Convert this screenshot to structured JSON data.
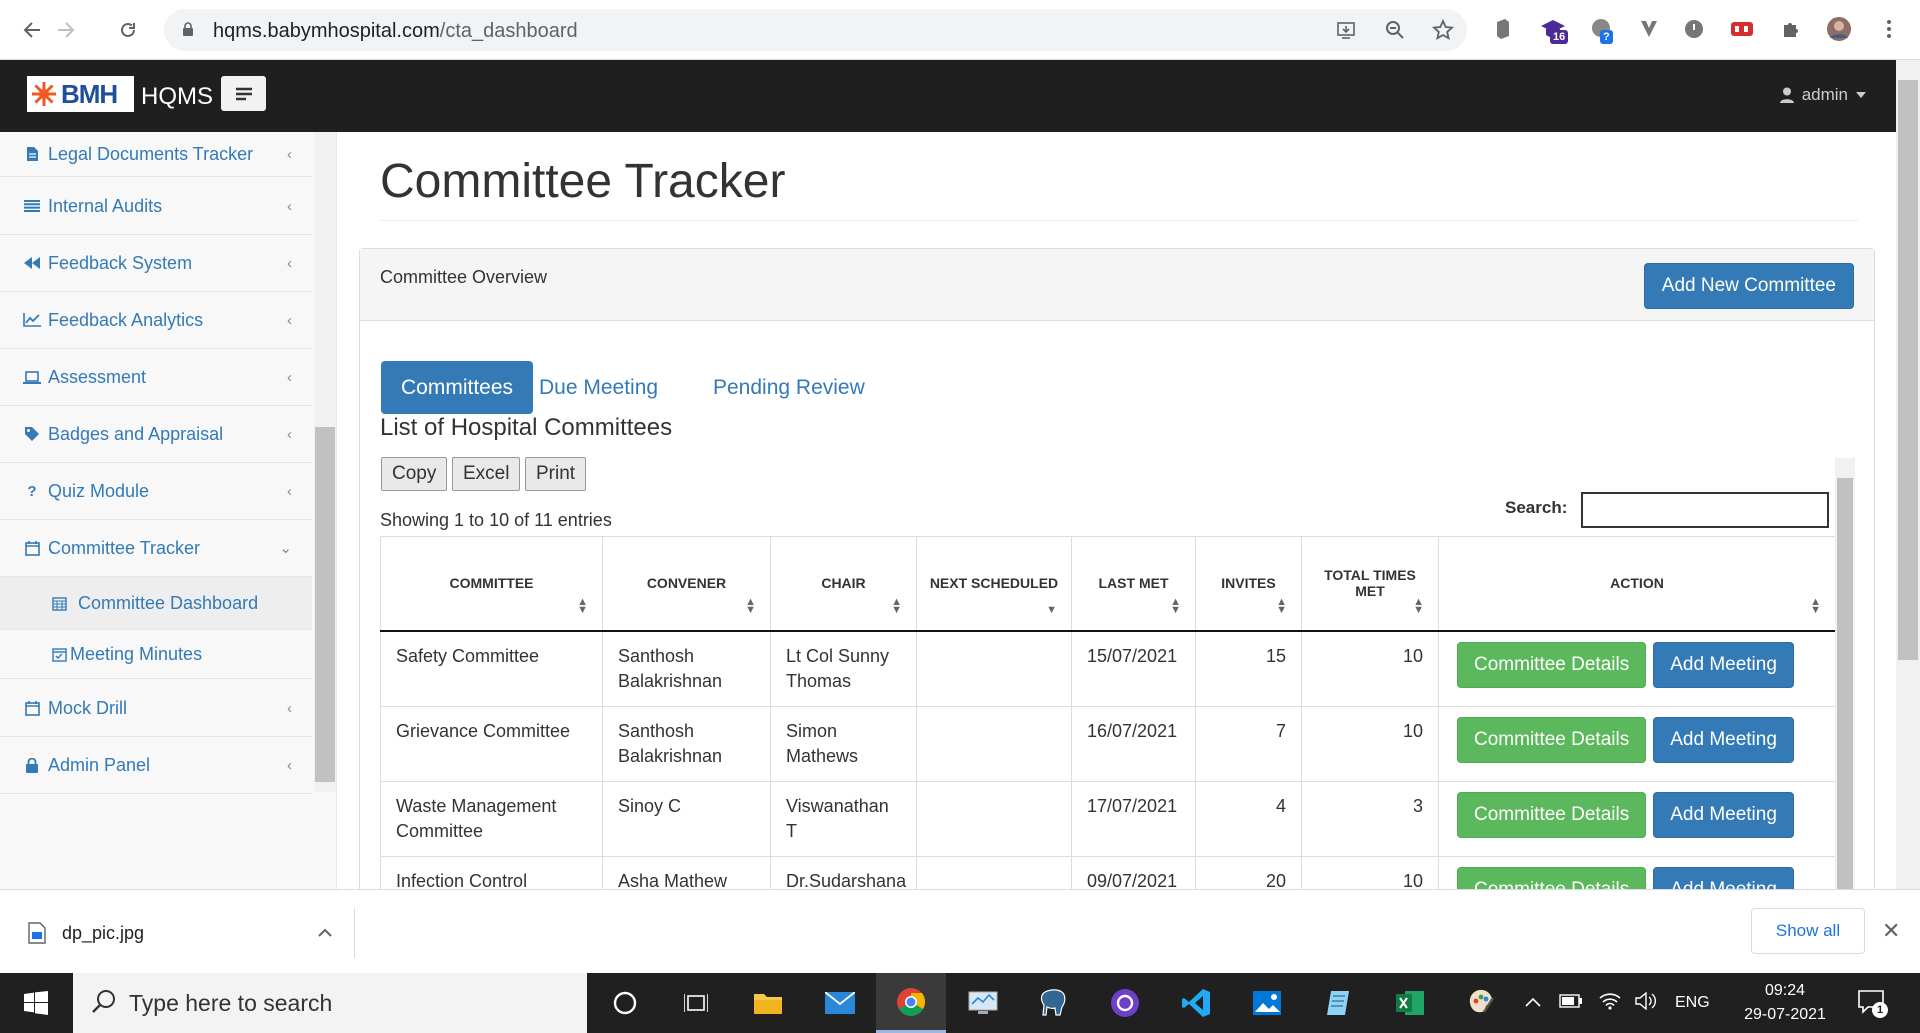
{
  "browser": {
    "url_host": "hqms.babymhospital.com",
    "url_path": "/cta_dashboard",
    "extension_badges": {
      "ext_purple": "16",
      "ext_blue": "?"
    }
  },
  "header": {
    "logo_text": "BMH",
    "app_name": "HQMS",
    "user_label": "admin"
  },
  "sidebar": {
    "items": [
      {
        "label": "Legal Documents Tracker",
        "icon": "file-icon"
      },
      {
        "label": "Internal Audits",
        "icon": "list-icon"
      },
      {
        "label": "Feedback System",
        "icon": "backward-icon"
      },
      {
        "label": "Feedback Analytics",
        "icon": "line-chart-icon"
      },
      {
        "label": "Assessment",
        "icon": "laptop-icon"
      },
      {
        "label": "Badges and Appraisal",
        "icon": "tag-icon"
      },
      {
        "label": "Quiz Module",
        "icon": "question-icon"
      },
      {
        "label": "Committee Tracker",
        "icon": "calendar-icon"
      },
      {
        "label": "Mock Drill",
        "icon": "calendar-icon"
      },
      {
        "label": "Admin Panel",
        "icon": "lock-icon"
      }
    ],
    "sub_items": [
      {
        "label": "Committee Dashboard",
        "icon": "calendar-grid-icon"
      },
      {
        "label": "Meeting Minutes",
        "icon": "calendar-check-icon"
      }
    ]
  },
  "main": {
    "page_title": "Committee Tracker",
    "panel_title": "Committee Overview",
    "add_button": "Add New Committee",
    "tabs": [
      {
        "label": "Committees",
        "active": true
      },
      {
        "label": "Due Meeting",
        "active": false
      },
      {
        "label": "Pending Review",
        "active": false
      }
    ],
    "list_heading": "List of Hospital Committees",
    "export_buttons": [
      "Copy",
      "Excel",
      "Print"
    ],
    "entries_info": "Showing 1 to 10 of 11 entries",
    "search_label": "Search:",
    "search_value": ""
  },
  "table": {
    "columns": [
      "Committee",
      "Convener",
      "Chair",
      "Next Scheduled",
      "Last Met",
      "Invites",
      "Total Times Met",
      "Action"
    ],
    "rows": [
      {
        "committee": "Safety Committee",
        "convener": "Santhosh Balakrishnan",
        "chair": "Lt Col Sunny Thomas",
        "next": "",
        "last_met": "15/07/2021",
        "invites": "15",
        "times_met": "10"
      },
      {
        "committee": "Grievance Committee",
        "convener": "Santhosh Balakrishnan",
        "chair": "Simon Mathews",
        "next": "",
        "last_met": "16/07/2021",
        "invites": "7",
        "times_met": "10"
      },
      {
        "committee": "Waste Management Committee",
        "convener": "Sinoy C",
        "chair": "Viswanathan T",
        "next": "",
        "last_met": "17/07/2021",
        "invites": "4",
        "times_met": "3"
      },
      {
        "committee": "Infection Control",
        "convener": "Asha Mathew",
        "chair": "Dr.Sudarshana",
        "next": "",
        "last_met": "09/07/2021",
        "invites": "20",
        "times_met": "10"
      }
    ],
    "details_button": "Committee Details",
    "add_meeting_button": "Add Meeting"
  },
  "downloads": {
    "file_name": "dp_pic.jpg",
    "show_all": "Show all"
  },
  "taskbar": {
    "search_placeholder": "Type here to search",
    "language": "ENG",
    "time": "09:24",
    "date": "29-07-2021",
    "notification_count": "1"
  },
  "colors": {
    "primary": "#337ab7",
    "success": "#5cb85c",
    "topbar": "#1f1f1f",
    "logo_orange": "#f05a22"
  }
}
